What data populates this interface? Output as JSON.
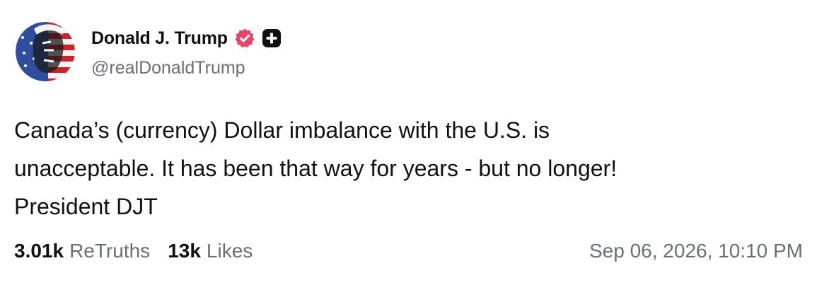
{
  "post": {
    "author_name": "Donald J. Trump",
    "handle": "@realDonaldTrump",
    "verified_icon": "verified-badge-icon",
    "plus_icon": "plus-badge-icon",
    "body_lines": [
      "Canada’s (currency) Dollar imbalance with the U.S. is",
      "unacceptable. It has been that way for years - but no longer!",
      "President DJT"
    ],
    "stats": {
      "retruths_count": "3.01k",
      "retruths_label": "ReTruths",
      "likes_count": "13k",
      "likes_label": "Likes"
    },
    "timestamp": "Sep 06, 2026, 10:10 PM"
  },
  "colors": {
    "verified": "#e4476b",
    "plus_badge": "#111111",
    "muted_text": "#6b6e76"
  }
}
